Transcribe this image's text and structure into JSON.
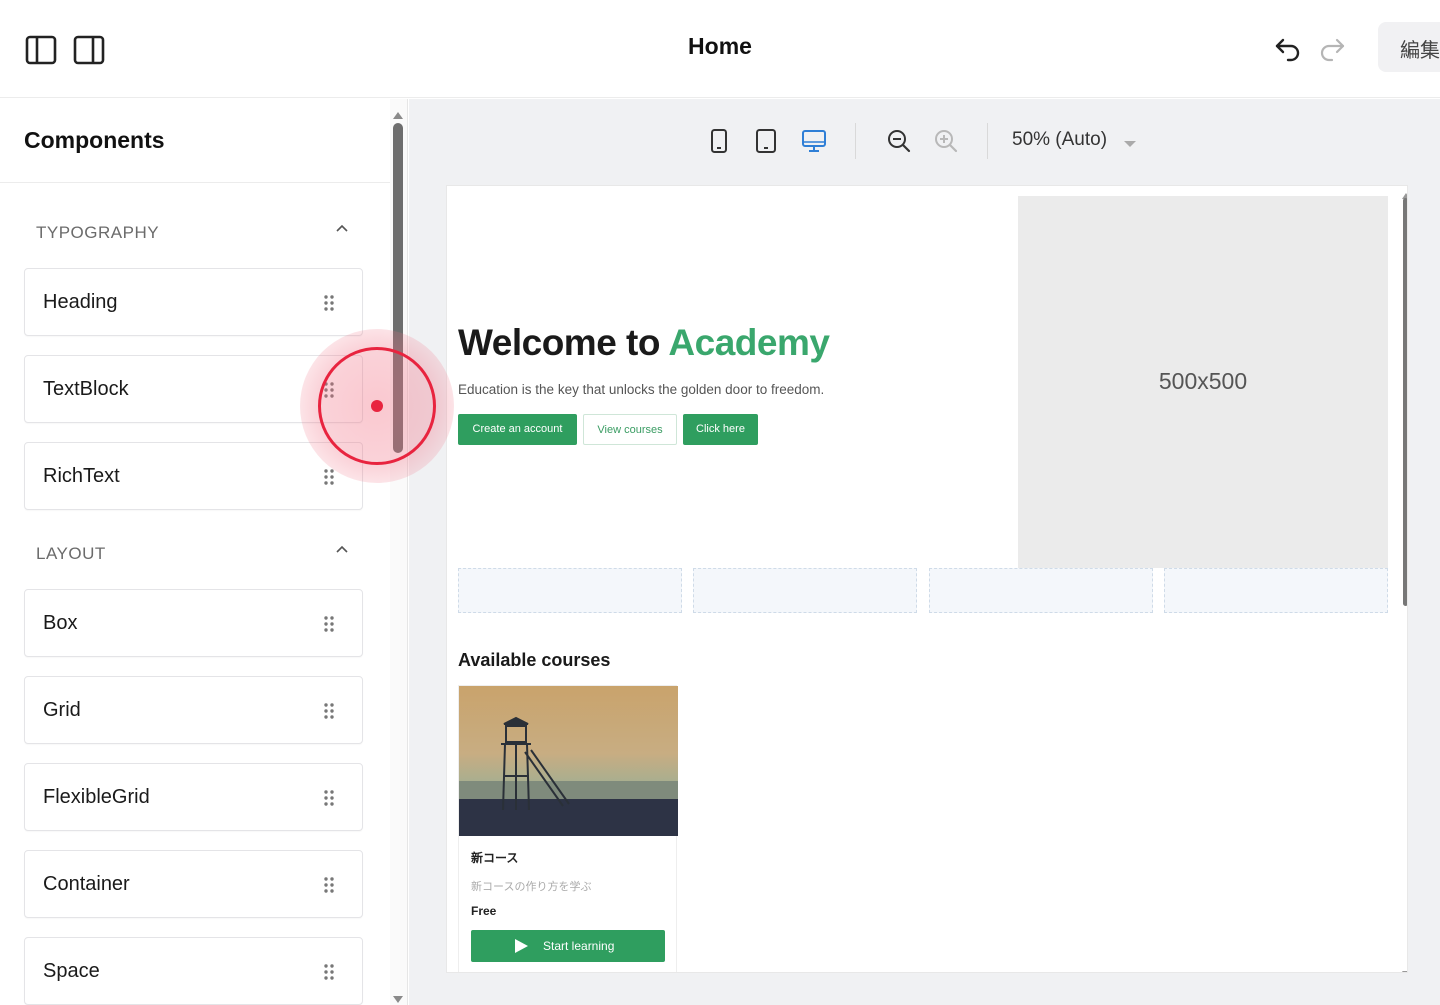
{
  "topbar": {
    "title": "Home",
    "edit_label": "編集"
  },
  "sidebar": {
    "title": "Components",
    "sections": [
      {
        "label": "TYPOGRAPHY",
        "items": [
          "Heading",
          "TextBlock",
          "RichText"
        ]
      },
      {
        "label": "LAYOUT",
        "items": [
          "Box",
          "Grid",
          "FlexibleGrid",
          "Container",
          "Space"
        ]
      }
    ]
  },
  "canvas": {
    "zoom_label": "50% (Auto)",
    "active_device": "desktop",
    "colors": {
      "accent": "#3aa76d",
      "primary_button": "#2f9e5f",
      "selected_device": "#2f7fd6"
    }
  },
  "preview": {
    "hero_title_prefix": "Welcome to ",
    "hero_title_accent": "Academy",
    "hero_subtitle": "Education is the key that unlocks the golden door to freedom.",
    "buttons": [
      "Create an account",
      "View courses",
      "Click here"
    ],
    "image_placeholder": "500x500",
    "courses_heading": "Available courses",
    "course": {
      "name": "新コース",
      "description": "新コースの作り方を学ぶ",
      "price": "Free",
      "button_label": "Start learning"
    }
  }
}
